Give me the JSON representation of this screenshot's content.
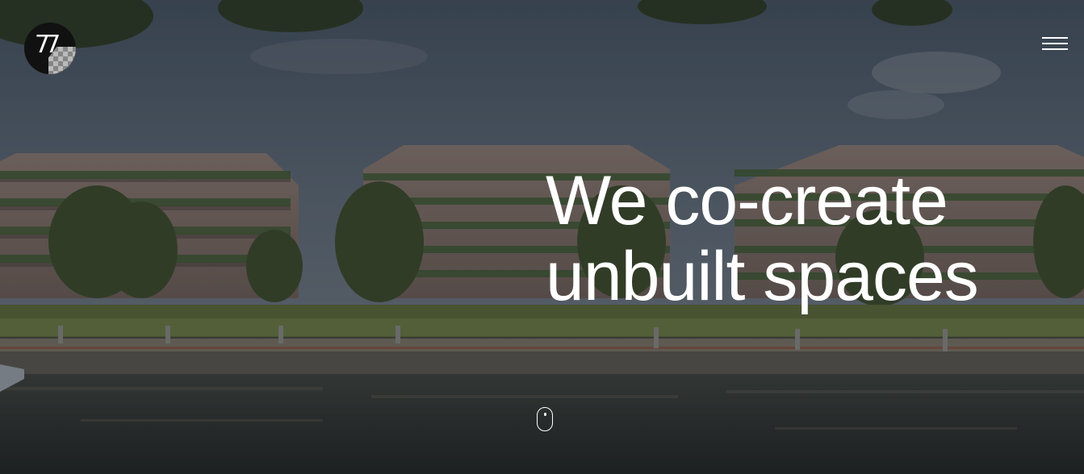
{
  "brand": {
    "logo_text": "77"
  },
  "hero": {
    "headline_line1": "We co-create",
    "headline_line2": "unbuilt spaces"
  },
  "icons": {
    "menu": "hamburger-menu-icon",
    "scroll": "mouse-scroll-icon"
  },
  "colors": {
    "text": "#ffffff",
    "logo_bg": "#111111"
  }
}
